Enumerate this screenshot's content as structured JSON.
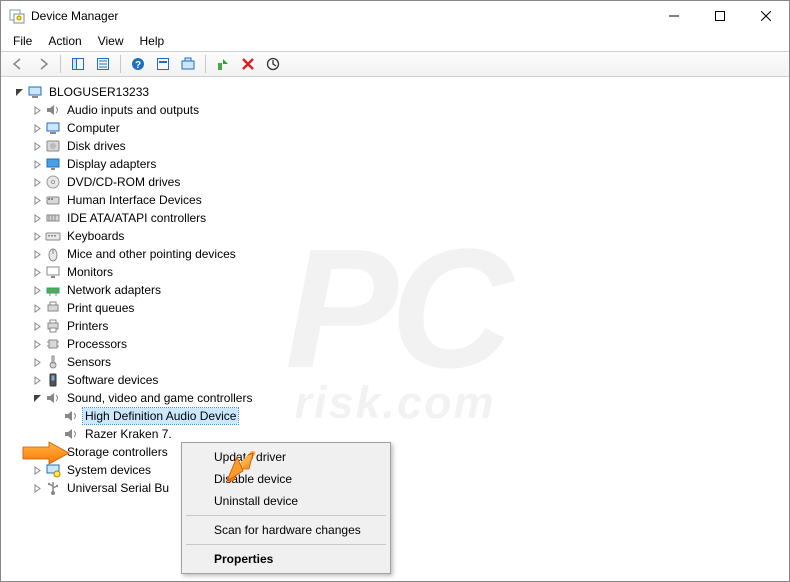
{
  "window": {
    "title": "Device Manager"
  },
  "menu": {
    "file": "File",
    "action": "Action",
    "view": "View",
    "help": "Help"
  },
  "tree": {
    "root": "BLOGUSER13233",
    "categories": [
      "Audio inputs and outputs",
      "Computer",
      "Disk drives",
      "Display adapters",
      "DVD/CD-ROM drives",
      "Human Interface Devices",
      "IDE ATA/ATAPI controllers",
      "Keyboards",
      "Mice and other pointing devices",
      "Monitors",
      "Network adapters",
      "Print queues",
      "Printers",
      "Processors",
      "Sensors",
      "Software devices",
      "Sound, video and game controllers",
      "Storage controllers",
      "System devices",
      "Universal Serial Bu"
    ],
    "sound_children": [
      "High Definition Audio Device",
      "Razer Kraken 7."
    ],
    "selected": "High Definition Audio Device"
  },
  "context_menu": {
    "update": "Update driver",
    "disable": "Disable device",
    "uninstall": "Uninstall device",
    "scan": "Scan for hardware changes",
    "properties": "Properties"
  },
  "watermark": {
    "big": "PC",
    "sub": "risk.com"
  }
}
